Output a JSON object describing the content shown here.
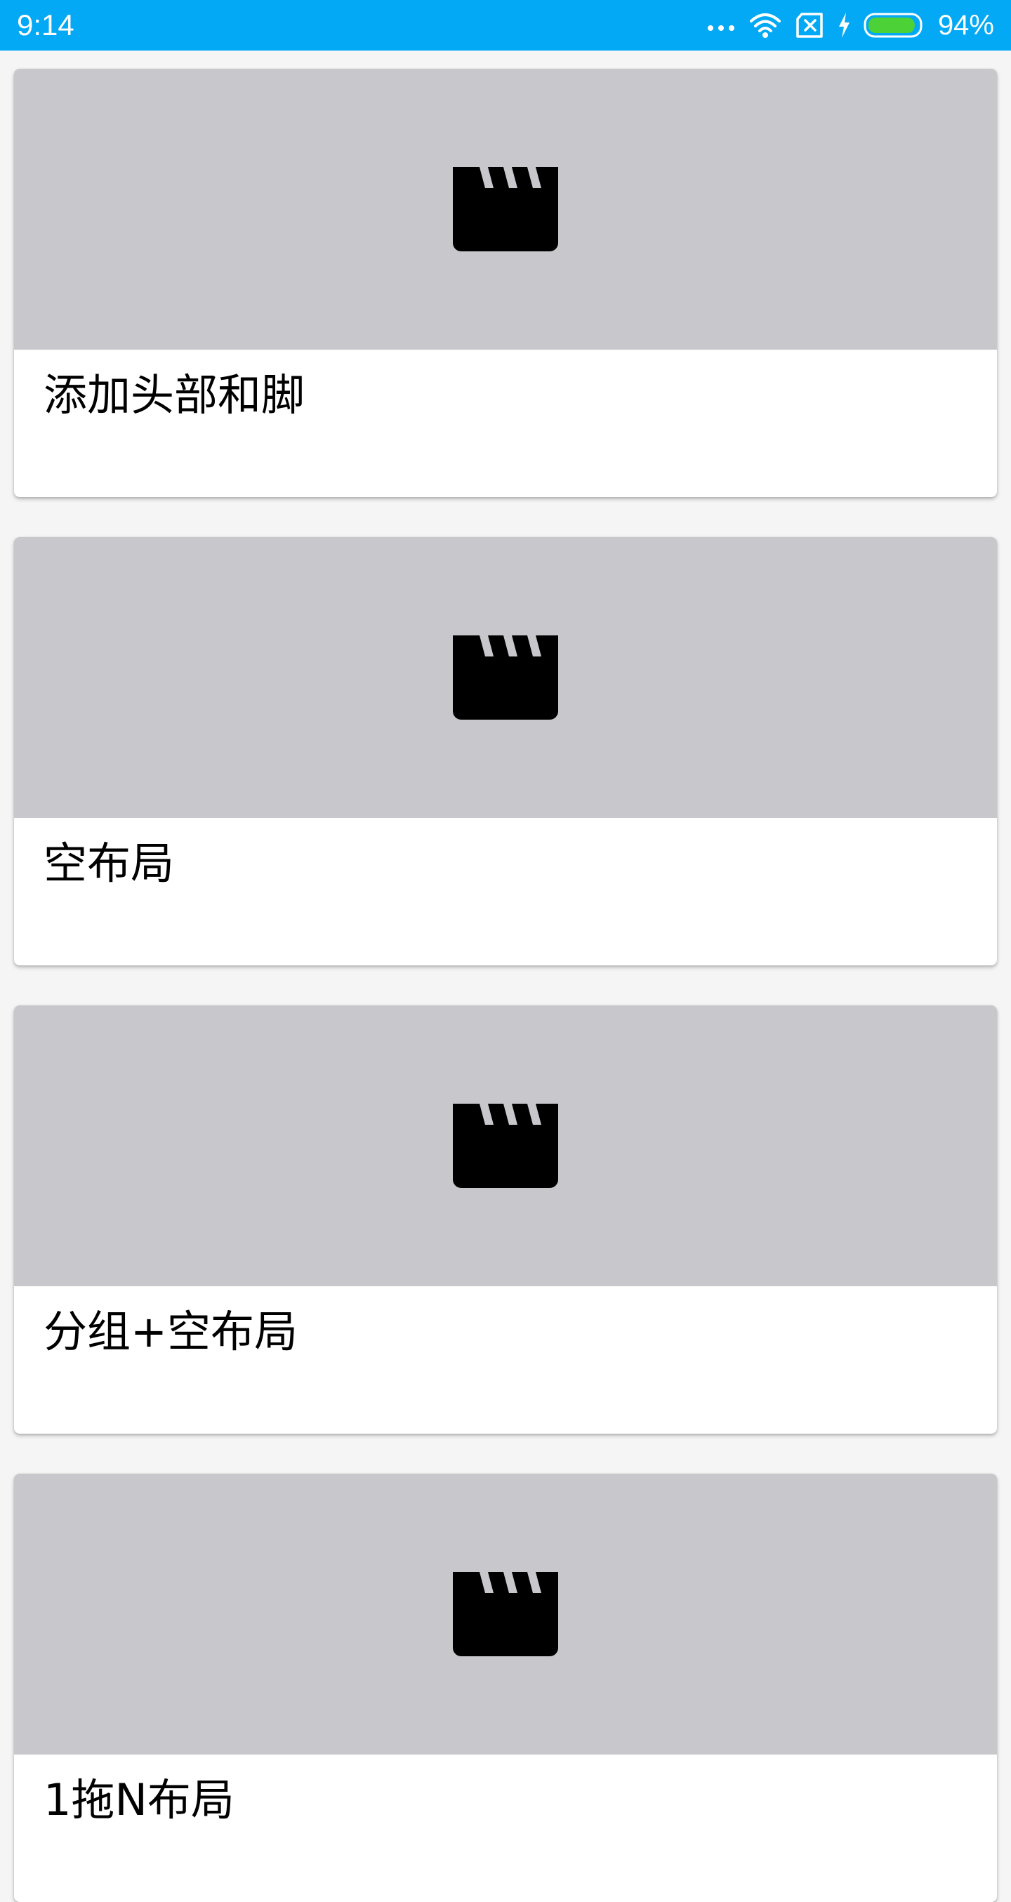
{
  "status_bar": {
    "time": "9:14",
    "battery_percent": "94%",
    "battery_level": 0.94,
    "icons": [
      "more-dots-icon",
      "wifi-icon",
      "no-sim-icon",
      "charging-icon",
      "battery-icon"
    ],
    "colors": {
      "background": "#03a9f4",
      "battery_fill": "#4cd137"
    }
  },
  "cards": [
    {
      "title": "添加头部和脚",
      "icon": "movie-clapper-icon"
    },
    {
      "title": "空布局",
      "icon": "movie-clapper-icon"
    },
    {
      "title": "分组+空布局",
      "icon": "movie-clapper-icon"
    },
    {
      "title": "1拖N布局",
      "icon": "movie-clapper-icon"
    }
  ],
  "colors": {
    "media_background": "#c8c7cc",
    "page_background": "#f5f5f5",
    "card_background": "#ffffff"
  }
}
